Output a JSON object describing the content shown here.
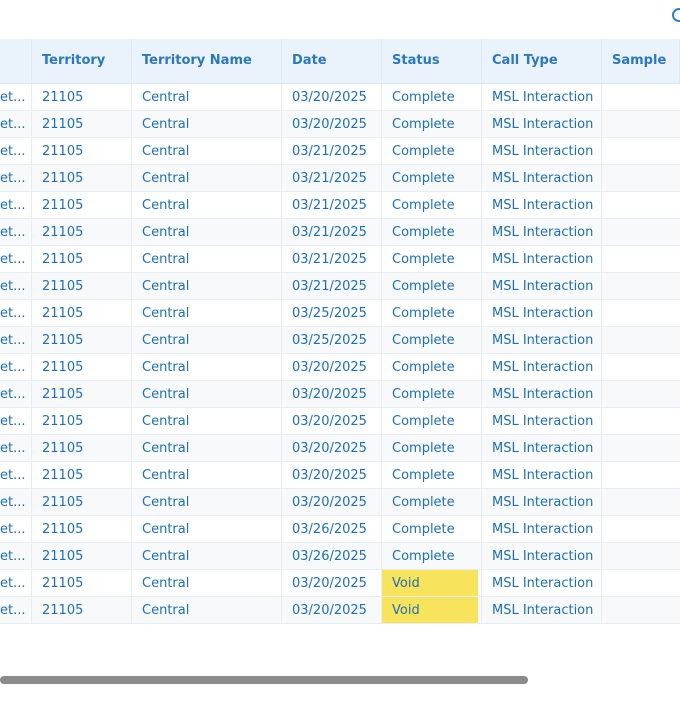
{
  "header": {
    "columns": [
      "",
      "Territory",
      "Territory Name",
      "Date",
      "Status",
      "Call Type",
      "Sample"
    ]
  },
  "rows": [
    {
      "prefix": "et...",
      "territory": "21105",
      "territory_name": "Central",
      "date": "03/20/2025",
      "status": "Complete",
      "call_type": "MSL Interaction",
      "sample": ""
    },
    {
      "prefix": "et...",
      "territory": "21105",
      "territory_name": "Central",
      "date": "03/20/2025",
      "status": "Complete",
      "call_type": "MSL Interaction",
      "sample": ""
    },
    {
      "prefix": "et...",
      "territory": "21105",
      "territory_name": "Central",
      "date": "03/21/2025",
      "status": "Complete",
      "call_type": "MSL Interaction",
      "sample": ""
    },
    {
      "prefix": "et...",
      "territory": "21105",
      "territory_name": "Central",
      "date": "03/21/2025",
      "status": "Complete",
      "call_type": "MSL Interaction",
      "sample": ""
    },
    {
      "prefix": "et...",
      "territory": "21105",
      "territory_name": "Central",
      "date": "03/21/2025",
      "status": "Complete",
      "call_type": "MSL Interaction",
      "sample": ""
    },
    {
      "prefix": "et...",
      "territory": "21105",
      "territory_name": "Central",
      "date": "03/21/2025",
      "status": "Complete",
      "call_type": "MSL Interaction",
      "sample": ""
    },
    {
      "prefix": "et...",
      "territory": "21105",
      "territory_name": "Central",
      "date": "03/21/2025",
      "status": "Complete",
      "call_type": "MSL Interaction",
      "sample": ""
    },
    {
      "prefix": "et...",
      "territory": "21105",
      "territory_name": "Central",
      "date": "03/21/2025",
      "status": "Complete",
      "call_type": "MSL Interaction",
      "sample": ""
    },
    {
      "prefix": "et...",
      "territory": "21105",
      "territory_name": "Central",
      "date": "03/25/2025",
      "status": "Complete",
      "call_type": "MSL Interaction",
      "sample": ""
    },
    {
      "prefix": "et...",
      "territory": "21105",
      "territory_name": "Central",
      "date": "03/25/2025",
      "status": "Complete",
      "call_type": "MSL Interaction",
      "sample": ""
    },
    {
      "prefix": "et...",
      "territory": "21105",
      "territory_name": "Central",
      "date": "03/20/2025",
      "status": "Complete",
      "call_type": "MSL Interaction",
      "sample": ""
    },
    {
      "prefix": "et...",
      "territory": "21105",
      "territory_name": "Central",
      "date": "03/20/2025",
      "status": "Complete",
      "call_type": "MSL Interaction",
      "sample": ""
    },
    {
      "prefix": "et...",
      "territory": "21105",
      "territory_name": "Central",
      "date": "03/20/2025",
      "status": "Complete",
      "call_type": "MSL Interaction",
      "sample": ""
    },
    {
      "prefix": "et...",
      "territory": "21105",
      "territory_name": "Central",
      "date": "03/20/2025",
      "status": "Complete",
      "call_type": "MSL Interaction",
      "sample": ""
    },
    {
      "prefix": "et...",
      "territory": "21105",
      "territory_name": "Central",
      "date": "03/20/2025",
      "status": "Complete",
      "call_type": "MSL Interaction",
      "sample": ""
    },
    {
      "prefix": "et...",
      "territory": "21105",
      "territory_name": "Central",
      "date": "03/20/2025",
      "status": "Complete",
      "call_type": "MSL Interaction",
      "sample": ""
    },
    {
      "prefix": "et...",
      "territory": "21105",
      "territory_name": "Central",
      "date": "03/26/2025",
      "status": "Complete",
      "call_type": "MSL Interaction",
      "sample": ""
    },
    {
      "prefix": "et...",
      "territory": "21105",
      "territory_name": "Central",
      "date": "03/26/2025",
      "status": "Complete",
      "call_type": "MSL Interaction",
      "sample": ""
    },
    {
      "prefix": "et...",
      "territory": "21105",
      "territory_name": "Central",
      "date": "03/20/2025",
      "status": "Void",
      "call_type": "MSL Interaction",
      "sample": ""
    },
    {
      "prefix": "et...",
      "territory": "21105",
      "territory_name": "Central",
      "date": "03/20/2025",
      "status": "Void",
      "call_type": "MSL Interaction",
      "sample": ""
    }
  ],
  "colors": {
    "text": "#1f6fb3",
    "header_bg": "#eaf3fb",
    "void_highlight": "#f7e35c",
    "scrollbar": "#8b8b8b"
  },
  "icons": {
    "top_right": "circle-icon"
  }
}
